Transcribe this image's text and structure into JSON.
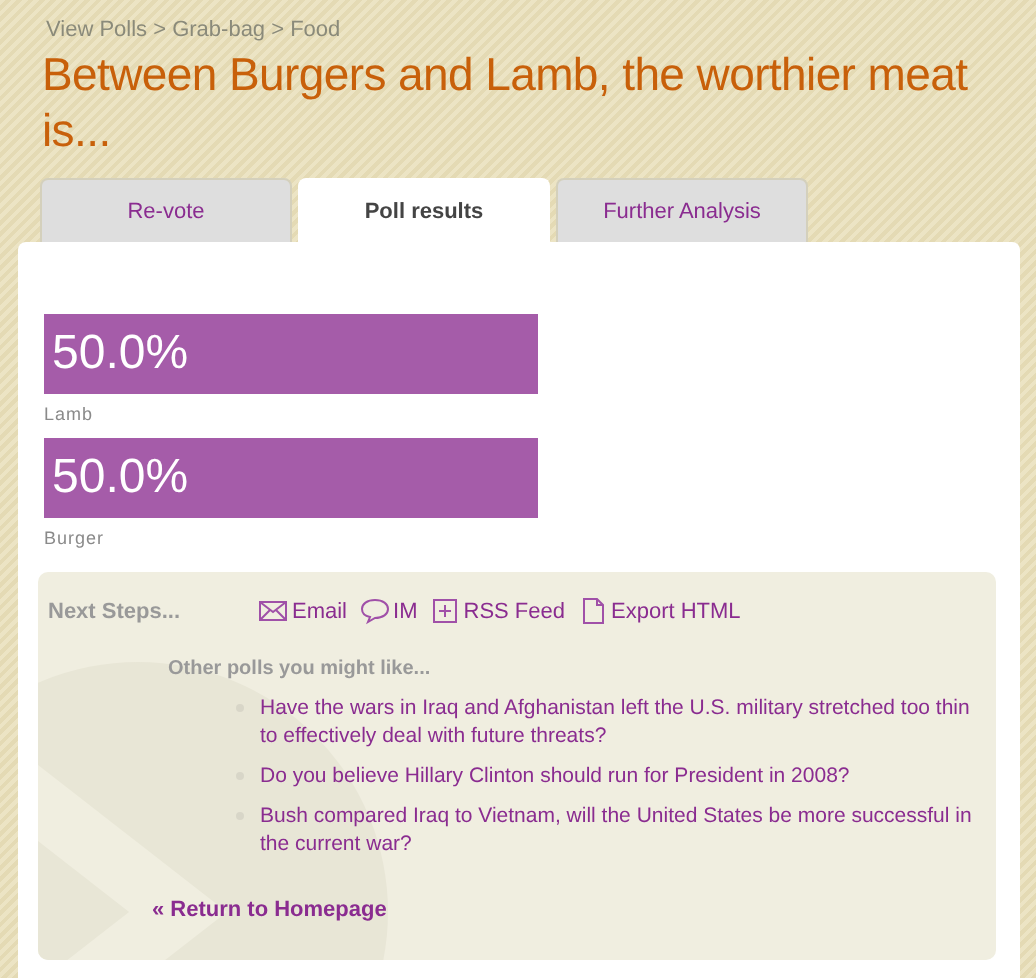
{
  "breadcrumb": "View Polls > Grab-bag > Food",
  "title": "Between Burgers and Lamb, the worthier meat is...",
  "tabs": [
    {
      "label": "Re-vote",
      "selected": false
    },
    {
      "label": "Poll results",
      "selected": true
    },
    {
      "label": "Further Analysis",
      "selected": false
    }
  ],
  "results": [
    {
      "reading": "50.0%",
      "label": "Lamb"
    },
    {
      "reading": "50.0%",
      "label": "Burger"
    }
  ],
  "next_steps": {
    "heading": "Next Steps...",
    "actions": [
      {
        "kind": "email",
        "label": "Email"
      },
      {
        "kind": "im",
        "label": "IM"
      },
      {
        "kind": "rss",
        "label": "RSS Feed"
      },
      {
        "kind": "export",
        "label": "Export HTML"
      }
    ],
    "other_polls_heading": "Other polls you might like...",
    "other_polls": [
      "Have the wars in Iraq and Afghanistan left the U.S. military stretched too thin to effectively deal with future threats?",
      "Do you believe Hillary Clinton should run for President in 2008?",
      "Bush compared Iraq to Vietnam, will the United States be more successful in the current war?"
    ],
    "return_link": "« Return to Homepage"
  }
}
